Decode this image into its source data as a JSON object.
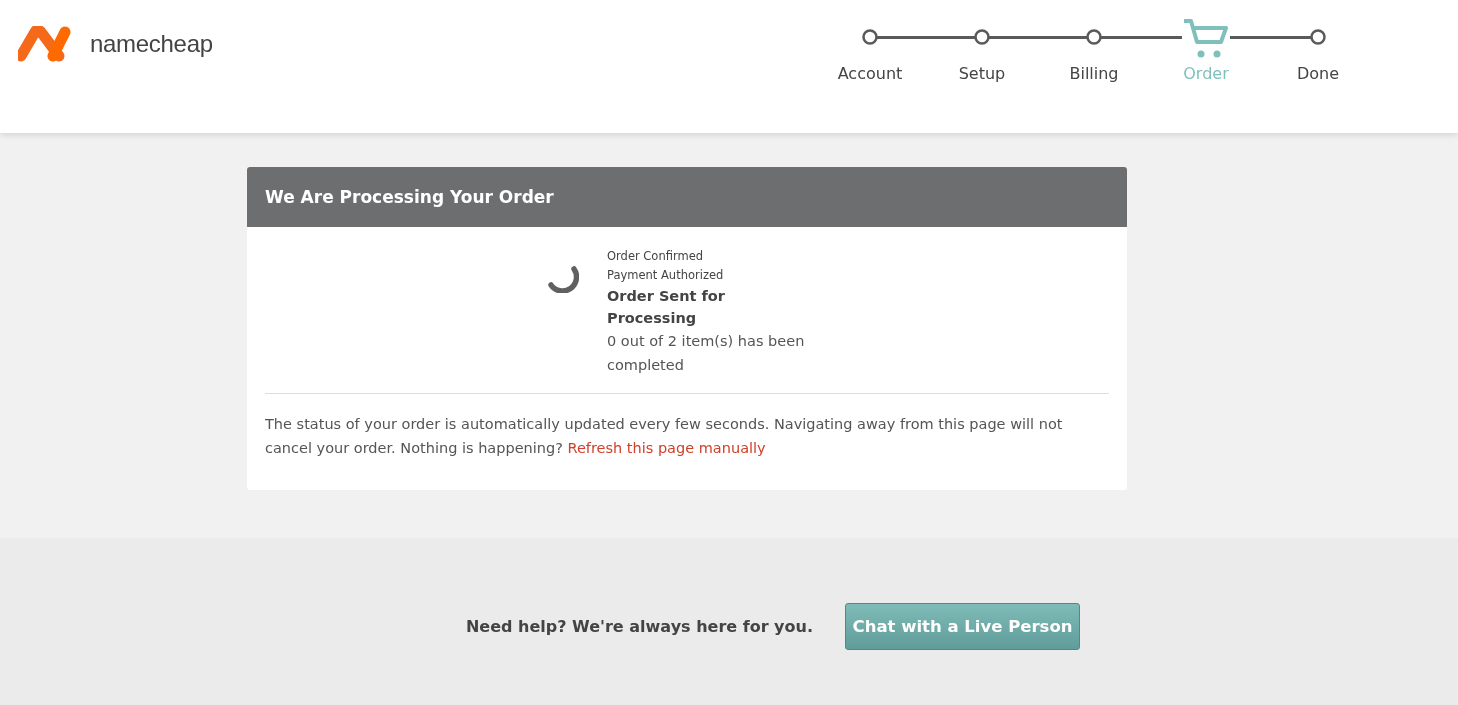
{
  "header": {
    "logo_text": "namecheap",
    "steps": [
      {
        "label": "Account",
        "selected": false
      },
      {
        "label": "Setup",
        "selected": false
      },
      {
        "label": "Billing",
        "selected": false
      },
      {
        "label": "Order",
        "selected": true
      },
      {
        "label": "Done",
        "selected": false
      }
    ]
  },
  "card": {
    "title": "We Are Processing Your Order",
    "status_lines": [
      {
        "text": "Order Confirmed",
        "kind": "done"
      },
      {
        "text": "Payment Authorized",
        "kind": "done"
      },
      {
        "text": "Order Sent for Processing",
        "kind": "current"
      }
    ],
    "progress_text": "0 out of 2 item(s) has been completed",
    "note": "The status of your order is automatically updated every few seconds. Navigating away from this page will not cancel your order. Nothing is happening?",
    "link": "Refresh this page manually"
  },
  "footer": {
    "help_text": "Need help? We're always here for you.",
    "button": "Chat with a Live Person"
  }
}
